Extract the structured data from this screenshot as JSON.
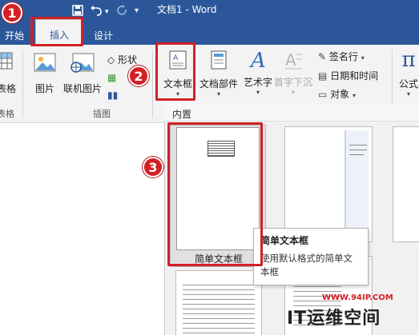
{
  "window": {
    "title": "文档1 - Word"
  },
  "tabs": {
    "start": "开始",
    "insert": "插入",
    "design": "设计"
  },
  "ribbon": {
    "table_fragment": "表格",
    "table_group_fragment": "表格",
    "picture": "图片",
    "online_picture": "联机图片",
    "shapes_fragment": "形状",
    "illustrations_group": "插图",
    "textbox": "文本框",
    "quick_parts": "文档部件",
    "wordart": "艺术字",
    "drop_cap": "首字下沉",
    "signature_line": "签名行",
    "date_time": "日期和时间",
    "object": "对象",
    "equation": "公式"
  },
  "gallery": {
    "section_label": "内置",
    "selected_caption": "简单文本框"
  },
  "tooltip": {
    "title": "简单文本框",
    "description": "使用默认格式的简单文本框"
  },
  "callouts": [
    "1",
    "2",
    "3"
  ],
  "watermark": {
    "url": "WWW.94IP.COM",
    "brand": "IT运维空间"
  },
  "colors": {
    "title_bar": "#2b579a",
    "callout_red": "#d32026",
    "ribbon_bg": "#f3f3f3"
  }
}
